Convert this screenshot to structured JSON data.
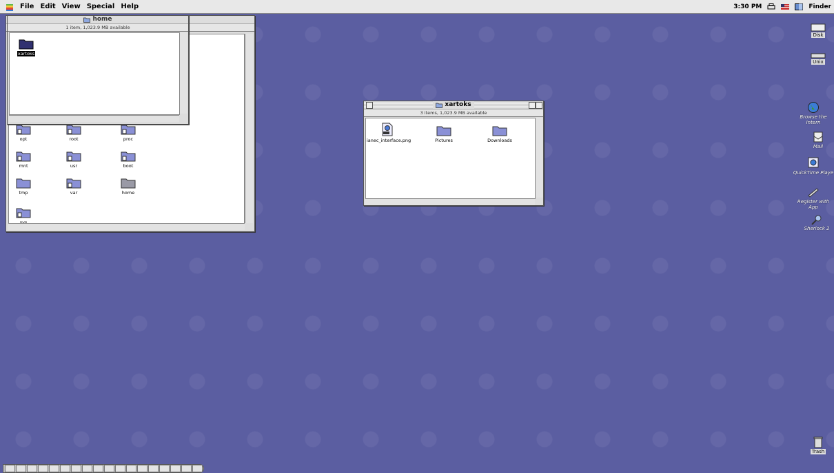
{
  "menubar": {
    "items": [
      "File",
      "Edit",
      "View",
      "Special",
      "Help"
    ],
    "clock": "3:30 PM",
    "app": "Finder"
  },
  "home_window": {
    "title": "home",
    "info": "1 item, 1,023.9 MB available",
    "items": [
      {
        "label": "xartoks"
      }
    ]
  },
  "root_window": {
    "folders": [
      "opt",
      "root",
      "proc",
      "mnt",
      "usr",
      "boot",
      "tmp",
      "var",
      "home",
      "svs"
    ]
  },
  "xartoks_window": {
    "title": "xartoks",
    "info": "3 items, 1,023.9 MB available",
    "items": [
      {
        "label": "ianec_interface.png",
        "kind": "png-file-icon"
      },
      {
        "label": "Pictures",
        "kind": "folder-icon"
      },
      {
        "label": "Downloads",
        "kind": "folder-icon"
      }
    ]
  },
  "desktop": {
    "icons": [
      "Disk",
      "Unix",
      "Browse the Intern",
      "Mail",
      "QuickTime Playe",
      "Register with App",
      "Sherlock 2",
      "Trash"
    ]
  },
  "colors": {
    "desktop": "#5b5ea1",
    "folder": "#8a90d6"
  }
}
